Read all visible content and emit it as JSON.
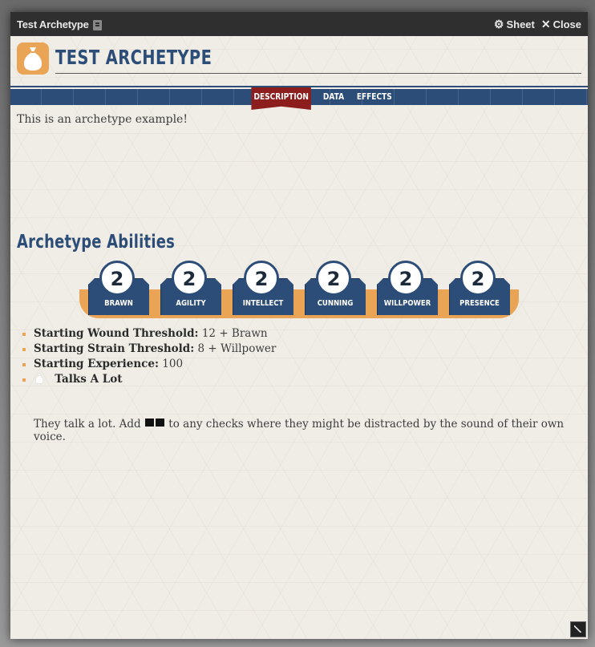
{
  "window": {
    "title": "Test Archetype",
    "sheet_label": "Sheet",
    "close_label": "Close"
  },
  "header": {
    "name": "TEST ARCHETYPE"
  },
  "tabs": [
    {
      "label": "DESCRIPTION",
      "active": true
    },
    {
      "label": "DATA",
      "active": false
    },
    {
      "label": "EFFECTS",
      "active": false
    }
  ],
  "description": "This is an archetype example!",
  "abilities": {
    "title": "Archetype Abilities",
    "characteristics": [
      {
        "label": "BRAWN",
        "value": "2"
      },
      {
        "label": "AGILITY",
        "value": "2"
      },
      {
        "label": "INTELLECT",
        "value": "2"
      },
      {
        "label": "CUNNING",
        "value": "2"
      },
      {
        "label": "WILLPOWER",
        "value": "2"
      },
      {
        "label": "PRESENCE",
        "value": "2"
      }
    ],
    "stats": [
      {
        "key": "Starting Wound Threshold:",
        "value": "12 + Brawn"
      },
      {
        "key": "Starting Strain Threshold:",
        "value": "8 + Willpower"
      },
      {
        "key": "Starting Experience:",
        "value": "100"
      }
    ],
    "talent": {
      "name": "Talks A Lot",
      "desc_before": "They talk a lot. Add",
      "desc_after": "to any checks where they might be distracted by the sound of their own voice."
    }
  },
  "colors": {
    "accent_blue": "#2c4d77",
    "accent_orange": "#e9a456",
    "active_tab_red": "#8c1e1e"
  }
}
